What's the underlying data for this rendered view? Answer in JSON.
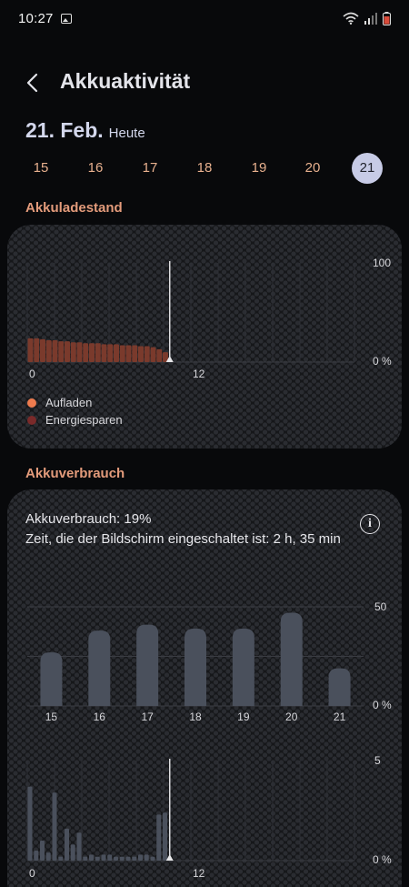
{
  "status": {
    "time": "10:27",
    "icons": [
      "gallery-icon",
      "wifi-icon",
      "signal-icon",
      "battery-icon"
    ]
  },
  "header": {
    "title": "Akkuaktivität",
    "back_icon": "chevron-left-icon"
  },
  "date": {
    "main": "21. Feb.",
    "sub": "Heute"
  },
  "days": [
    "15",
    "16",
    "17",
    "18",
    "19",
    "20",
    "21"
  ],
  "selected_day": "21",
  "colors": {
    "accent": "#e39b7b",
    "selected_day_bg": "#c7cbe6",
    "charging": "#ee7b4e",
    "power_saving": "#7a2a2a",
    "bar": "#4a505c"
  },
  "level_section": {
    "title": "Akkuladestand",
    "legend": [
      {
        "label": "Aufladen",
        "color": "#ee7b4e"
      },
      {
        "label": "Energiesparen",
        "color": "#7a2a2a"
      }
    ]
  },
  "usage_section": {
    "title": "Akkuverbrauch",
    "usage_text": "Akkuverbrauch: 19%",
    "screen_time_text": "Zeit, die der Bildschirm eingeschaltet ist: 2 h, 35 min",
    "info_icon": "info-icon"
  },
  "chart_data": [
    {
      "type": "bar",
      "title": "Akkuladestand",
      "x_tick_labels": [
        "0",
        "12"
      ],
      "y_tick_labels": [
        "100",
        "0 %"
      ],
      "ylim": [
        0,
        100
      ],
      "x_unit": "hour",
      "x_range": [
        0,
        24
      ],
      "current_hour": 10.45,
      "x": [
        0.0,
        0.45,
        0.9,
        1.35,
        1.8,
        2.25,
        2.7,
        3.15,
        3.6,
        4.05,
        4.5,
        4.95,
        5.4,
        5.85,
        6.3,
        6.75,
        7.2,
        7.65,
        8.1,
        8.55,
        9.0,
        9.45,
        9.9
      ],
      "values": [
        24,
        24,
        23,
        22,
        22,
        21,
        21,
        20,
        20,
        19,
        19,
        19,
        18,
        18,
        18,
        17,
        17,
        17,
        16,
        16,
        15,
        13,
        10
      ],
      "series": [
        {
          "name": "Energiesparen",
          "color": "#7a3a2c"
        }
      ]
    },
    {
      "type": "bar",
      "title": "Akkuverbrauch",
      "categories": [
        "15",
        "16",
        "17",
        "18",
        "19",
        "20",
        "21"
      ],
      "values": [
        27,
        38,
        41,
        39,
        39,
        47,
        19
      ],
      "y_tick_labels": [
        "50",
        "0 %"
      ],
      "ylim": [
        0,
        50
      ],
      "gridlines": [
        0,
        25,
        50
      ]
    },
    {
      "type": "bar",
      "x_tick_labels": [
        "0",
        "12"
      ],
      "y_tick_labels": [
        "5",
        "0 %"
      ],
      "ylim": [
        0,
        5
      ],
      "x_unit": "hour",
      "x_range": [
        0,
        24
      ],
      "current_hour": 10.45,
      "x": [
        0.0,
        0.45,
        0.9,
        1.35,
        1.8,
        2.25,
        2.7,
        3.15,
        3.6,
        4.05,
        4.5,
        4.95,
        5.4,
        5.85,
        6.3,
        6.75,
        7.2,
        7.65,
        8.1,
        8.55,
        9.0,
        9.45,
        9.9
      ],
      "values": [
        3.7,
        0.5,
        1.0,
        0.4,
        3.4,
        0.2,
        1.6,
        0.8,
        1.4,
        0.2,
        0.3,
        0.2,
        0.3,
        0.3,
        0.2,
        0.2,
        0.2,
        0.2,
        0.3,
        0.3,
        0.2,
        2.3,
        2.4
      ]
    }
  ]
}
